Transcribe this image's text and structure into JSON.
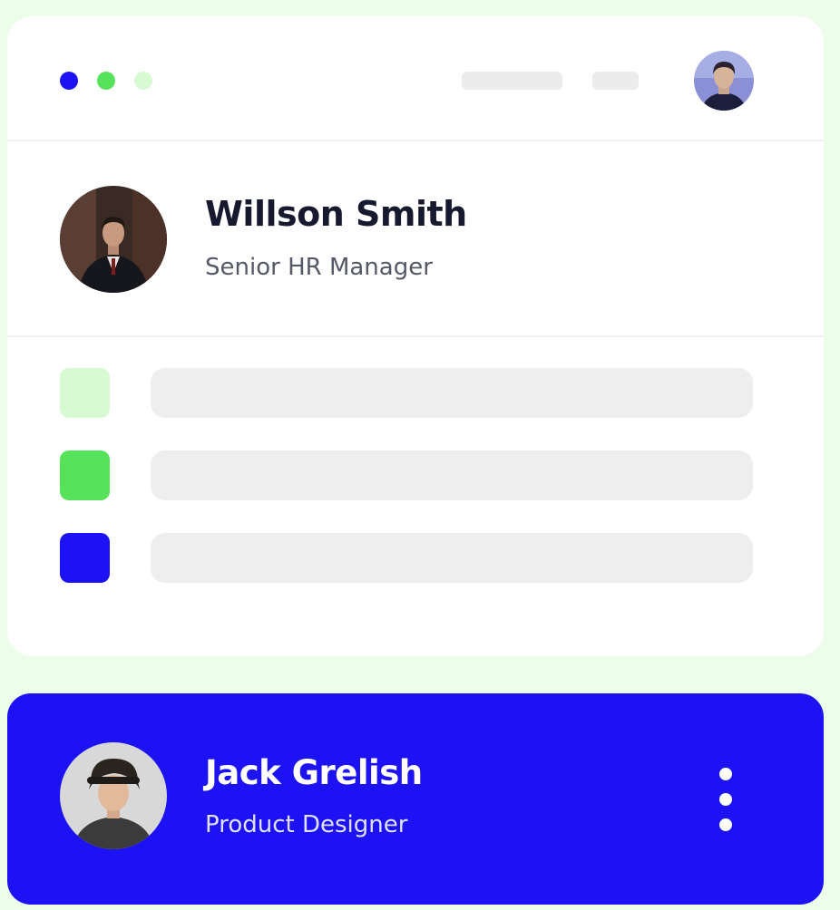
{
  "colors": {
    "background": "#ecfdea",
    "accent_blue": "#1c12f4",
    "accent_green": "#56e25a",
    "light_green": "#d7fad3",
    "skeleton": "#eeeeee"
  },
  "window_controls": [
    {
      "name": "blue",
      "color": "#1c12f4"
    },
    {
      "name": "green",
      "color": "#56e25a"
    },
    {
      "name": "light-green",
      "color": "#d7fad3"
    }
  ],
  "profile_card": {
    "name": "Willson Smith",
    "role": "Senior HR Manager"
  },
  "list_items": [
    {
      "marker_color": "#d7fad3",
      "icon": "square"
    },
    {
      "marker_color": "#56e25a",
      "icon": "square"
    },
    {
      "marker_color": "#1c12f4",
      "icon": "square"
    }
  ],
  "selected_card": {
    "name": "Jack Grelish",
    "role": "Product Designer",
    "menu_icon": "more-vertical-icon"
  }
}
